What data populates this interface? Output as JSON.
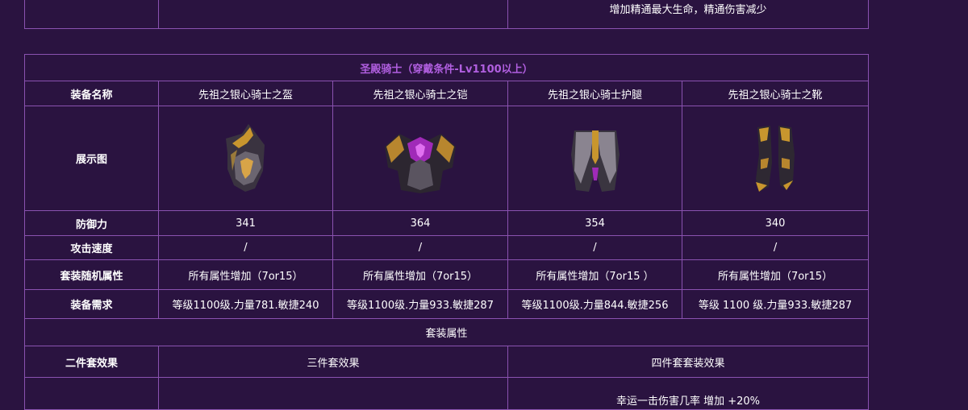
{
  "top_row": {
    "note": "增加精通最大生命，精通伤害减少"
  },
  "section": {
    "title": "圣殿骑士（穿戴条件-Lv1100以上）",
    "row_labels": {
      "name": "装备名称",
      "image": "展示图",
      "defense": "防御力",
      "attack_speed": "攻击速度",
      "random_attr": "套装随机属性",
      "requirement": "装备需求"
    },
    "items": [
      {
        "name": "先祖之银心骑士之盔",
        "defense": "341",
        "attack_speed": "/",
        "random_attr": "所有属性增加（7or15）",
        "requirement": "等级1100级.力量781.敏捷240",
        "icon": "helmet-icon"
      },
      {
        "name": "先祖之银心骑士之铠",
        "defense": "364",
        "attack_speed": "/",
        "random_attr": "所有属性增加（7or15）",
        "requirement": "等级1100级.力量933.敏捷287",
        "icon": "armor-icon"
      },
      {
        "name": "先祖之银心骑士护腿",
        "defense": "354",
        "attack_speed": "/",
        "random_attr": "所有属性增加（7or15 ）",
        "requirement": "等级1100级.力量844.敏捷256",
        "icon": "leggings-icon"
      },
      {
        "name": "先祖之银心骑士之靴",
        "defense": "340",
        "attack_speed": "/",
        "random_attr": "所有属性增加（7or15）",
        "requirement": "等级 1100 级.力量933.敏捷287",
        "icon": "boots-icon"
      }
    ],
    "set_attr_title": "套装属性",
    "set_effects": {
      "two_piece": "二件套效果",
      "three_piece": "三件套效果",
      "four_piece": "四件套套装效果",
      "four_piece_detail": "幸运一击伤害几率 增加 +20%"
    }
  },
  "colors": {
    "background": "#2a1340",
    "border": "#8a52b0",
    "title": "#b15fe0",
    "text": "#ffffff"
  }
}
